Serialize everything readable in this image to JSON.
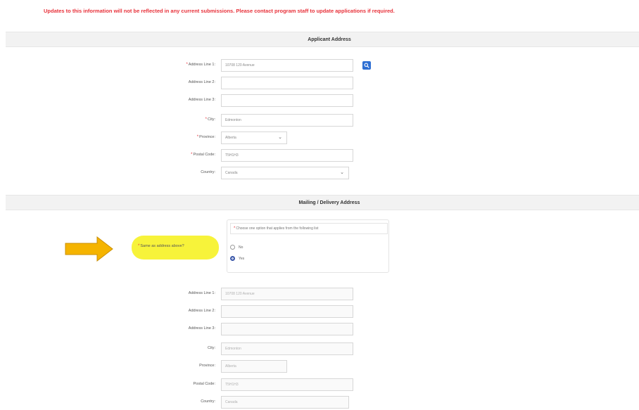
{
  "notice": "Updates to this information will not be reflected in any current submissions. Please contact program staff to update applications if required.",
  "applicant_address": {
    "title": "Applicant Address",
    "address_line1": {
      "label": "Address Line 1:",
      "value": "10708 120 Avenue"
    },
    "address_line2": {
      "label": "Address Line 2:",
      "value": ""
    },
    "address_line3": {
      "label": "Address Line 3:",
      "value": ""
    },
    "city": {
      "label": "City:",
      "value": "Edmonton"
    },
    "province": {
      "label": "Province:",
      "value": "Alberta"
    },
    "postal_code": {
      "label": "Postal Code:",
      "value": "T5H1H3"
    },
    "country": {
      "label": "Country:",
      "value": "Canada"
    }
  },
  "mailing_address": {
    "title": "Mailing / Delivery Address",
    "same_question": "Same as address above?",
    "radio_prompt": "Choose one option that applies from the following list",
    "options": [
      "No",
      "Yes"
    ],
    "selected": "Yes",
    "address_line1": {
      "label": "Address Line 1:",
      "value": "10708 120 Avenue"
    },
    "address_line2": {
      "label": "Address Line 2:",
      "value": ""
    },
    "address_line3": {
      "label": "Address Line 3:",
      "value": ""
    },
    "city": {
      "label": "City:",
      "value": "Edmonton"
    },
    "province": {
      "label": "Province:",
      "value": "Alberta"
    },
    "postal_code": {
      "label": "Postal Code:",
      "value": "T5H1H3"
    },
    "country": {
      "label": "Country:",
      "value": "Canada"
    }
  },
  "icons": {
    "lookup": "search-icon",
    "arrow": "arrow-right-icon"
  },
  "colors": {
    "notice": "#e8313a",
    "highlight": "#f7f33a",
    "arrow": "#f5b400",
    "lookup_button": "#2e6fd3"
  }
}
